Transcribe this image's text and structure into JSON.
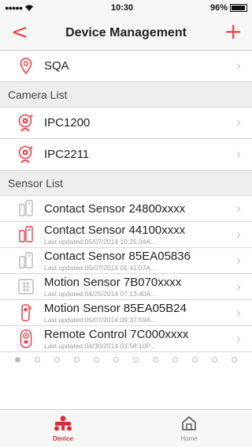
{
  "status_bar": {
    "time": "10:30",
    "battery": "96%"
  },
  "nav": {
    "title": "Device Management",
    "back": "<",
    "add": "+"
  },
  "site": {
    "name": "SQA"
  },
  "camera_section": {
    "title": "Camera List"
  },
  "cameras": [
    {
      "name": "IPC1200"
    },
    {
      "name": "IPC2211"
    }
  ],
  "sensor_section": {
    "title": "Sensor List"
  },
  "sensors": [
    {
      "name": "Contact Sensor 24800xxxx",
      "updated": "",
      "icon": "contact-sensor-icon",
      "color": "#b9b9b9"
    },
    {
      "name": "Contact Sensor 44100xxxx",
      "updated": "Last updated:05/07/2014 10:25:34A...",
      "icon": "contact-sensor-icon",
      "color": "#e8414a"
    },
    {
      "name": "Contact Sensor 85EA05836",
      "updated": "Last updated:05/07/2014 01:41:07A...",
      "icon": "contact-sensor-icon",
      "color": "#b9b9b9"
    },
    {
      "name": "Motion Sensor 7B070xxxx",
      "updated": "Last updated:04/25/2014 07:13:40A...",
      "icon": "motion-sensor-icon",
      "color": "#b9b9b9"
    },
    {
      "name": "Motion Sensor 85EA05B24",
      "updated": "Last updated:05/07/2014 09:37:59A...",
      "icon": "motion-sensor-icon",
      "color": "#e8414a"
    },
    {
      "name": "Remote Control 7C000xxxx",
      "updated": "Last updated:04/30/2014 03:58:10P...",
      "icon": "remote-control-icon",
      "color": "#e8414a"
    }
  ],
  "tabs": [
    {
      "label": "Device",
      "active": true
    },
    {
      "label": "Home",
      "active": false
    }
  ],
  "colors": {
    "accent": "#e8414a",
    "inactive": "#b9b9b9"
  }
}
